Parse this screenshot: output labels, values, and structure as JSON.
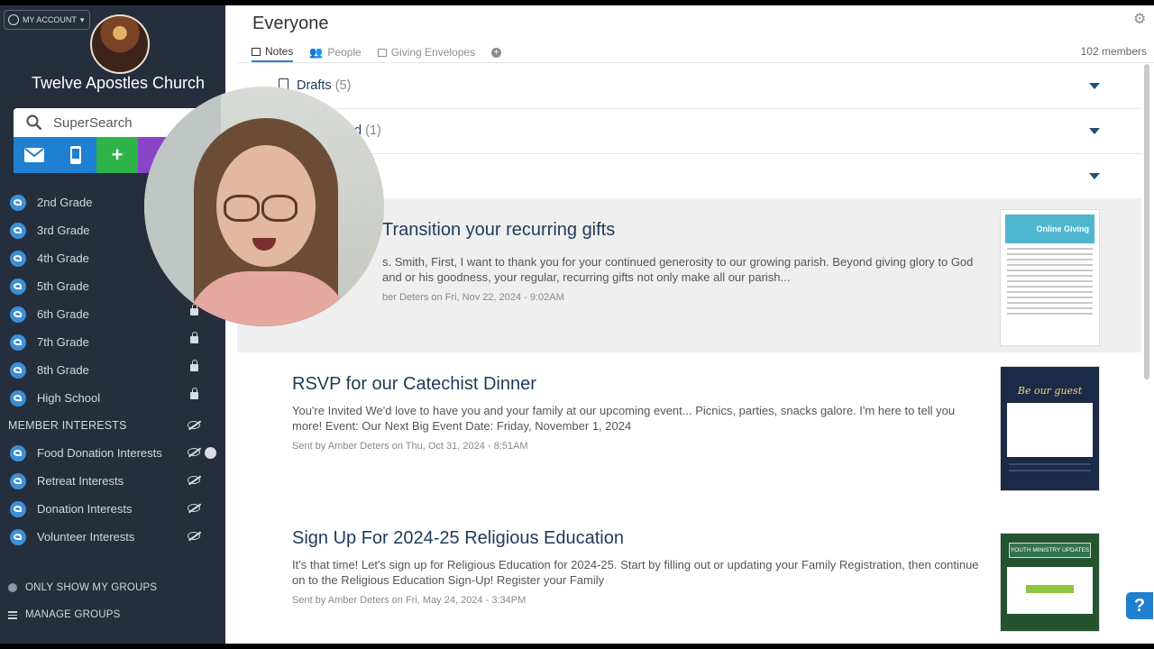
{
  "sidebar": {
    "account_label": "MY ACCOUNT",
    "church_name": "Twelve Apostles Church",
    "search_placeholder": "SuperSearch",
    "groups": [
      {
        "label": "2nd Grade",
        "locked": false
      },
      {
        "label": "3rd Grade",
        "locked": false
      },
      {
        "label": "4th Grade",
        "locked": false
      },
      {
        "label": "5th Grade",
        "locked": false
      },
      {
        "label": "6th Grade",
        "locked": true
      },
      {
        "label": "7th Grade",
        "locked": true
      },
      {
        "label": "8th Grade",
        "locked": true
      },
      {
        "label": "High School",
        "locked": true
      }
    ],
    "member_interests_header": "MEMBER INTERESTS",
    "interests": [
      {
        "label": "Food Donation Interests"
      },
      {
        "label": "Retreat Interests"
      },
      {
        "label": "Donation Interests"
      },
      {
        "label": "Volunteer Interests"
      }
    ],
    "only_show_my_groups": "ONLY SHOW MY GROUPS",
    "manage_groups": "MANAGE GROUPS"
  },
  "main": {
    "title": "Everyone",
    "tabs": [
      {
        "label": "Notes",
        "active": true
      },
      {
        "label": "People",
        "active": false
      },
      {
        "label": "Giving Envelopes",
        "active": false
      }
    ],
    "members_count": "102 members",
    "sections": [
      {
        "label": "Drafts",
        "count": "(5)"
      },
      {
        "label": "d",
        "count": "(1)"
      },
      {
        "label": "",
        "count": ""
      }
    ],
    "notes": [
      {
        "title": "Transition your recurring gifts",
        "body": "s. Smith, First, I want to thank you for your continued generosity to our growing parish. Beyond giving glory to God and or his goodness, your regular, recurring gifts not only make all our parish...",
        "sent": "ber Deters on Fri, Nov 22, 2024 - 9:02AM",
        "thumb_title": "Online Giving"
      },
      {
        "title": "RSVP for our Catechist Dinner",
        "body": "You're Invited We'd love to have you and your family at our upcoming event... Picnics, parties, snacks galore. I'm here to tell you more! Event: Our Next Big Event Date: Friday, November 1, 2024",
        "sent": "Sent by Amber Deters on Thu, Oct 31, 2024 - 8:51AM",
        "thumb_title": "Be our guest"
      },
      {
        "title": "Sign Up For 2024-25 Religious Education",
        "body": "It's that time! Let's sign up for Religious Education for 2024-25. Start by filling out or updating your Family Registration, then continue on to the Religious Education Sign-Up! Register your Family",
        "sent": "Sent by Amber Deters on Fri, May 24, 2024 - 3:34PM",
        "thumb_title": "YOUTH MINISTRY UPDATES"
      }
    ]
  },
  "help_label": "?"
}
